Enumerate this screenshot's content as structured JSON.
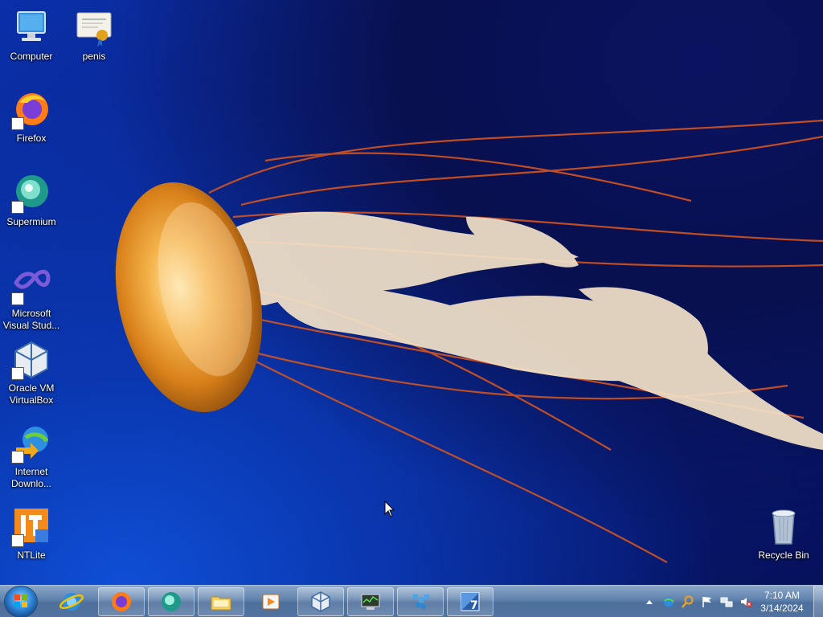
{
  "desktop": {
    "icons": [
      {
        "label": "Computer",
        "icon": "computer-icon"
      },
      {
        "label": "penis",
        "icon": "certificate-icon"
      },
      {
        "label": "Firefox",
        "icon": "firefox-icon"
      },
      {
        "label": "Supermium",
        "icon": "supermium-icon"
      },
      {
        "label": "Microsoft Visual Stud...",
        "icon": "visual-studio-icon"
      },
      {
        "label": "Oracle VM VirtualBox",
        "icon": "virtualbox-icon"
      },
      {
        "label": "Internet Downlo...",
        "icon": "internet-download-manager-icon"
      },
      {
        "label": "NTLite",
        "icon": "ntlite-icon"
      },
      {
        "label": "Recycle Bin",
        "icon": "recycle-bin-icon"
      }
    ]
  },
  "taskbar": {
    "start": "start-orb-icon",
    "pinned": [
      "internet-explorer-icon",
      "firefox-icon",
      "supermium-icon",
      "file-explorer-icon",
      "media-player-icon",
      "virtualbox-icon",
      "system-monitor-icon",
      "registry-icon",
      "windows-7-icon"
    ],
    "tray_icons": [
      "show-hidden-icons-icon",
      "network-globe-icon",
      "search-icon",
      "action-center-flag-icon",
      "network-icon",
      "volume-muted-icon"
    ],
    "clock": {
      "time": "7:10 AM",
      "date": "3/14/2024"
    }
  },
  "colors": {
    "wallpaper_blue": "#0a2fa8",
    "jellyfish_orange": "#e8901e",
    "taskbar": "#5f82ad"
  }
}
